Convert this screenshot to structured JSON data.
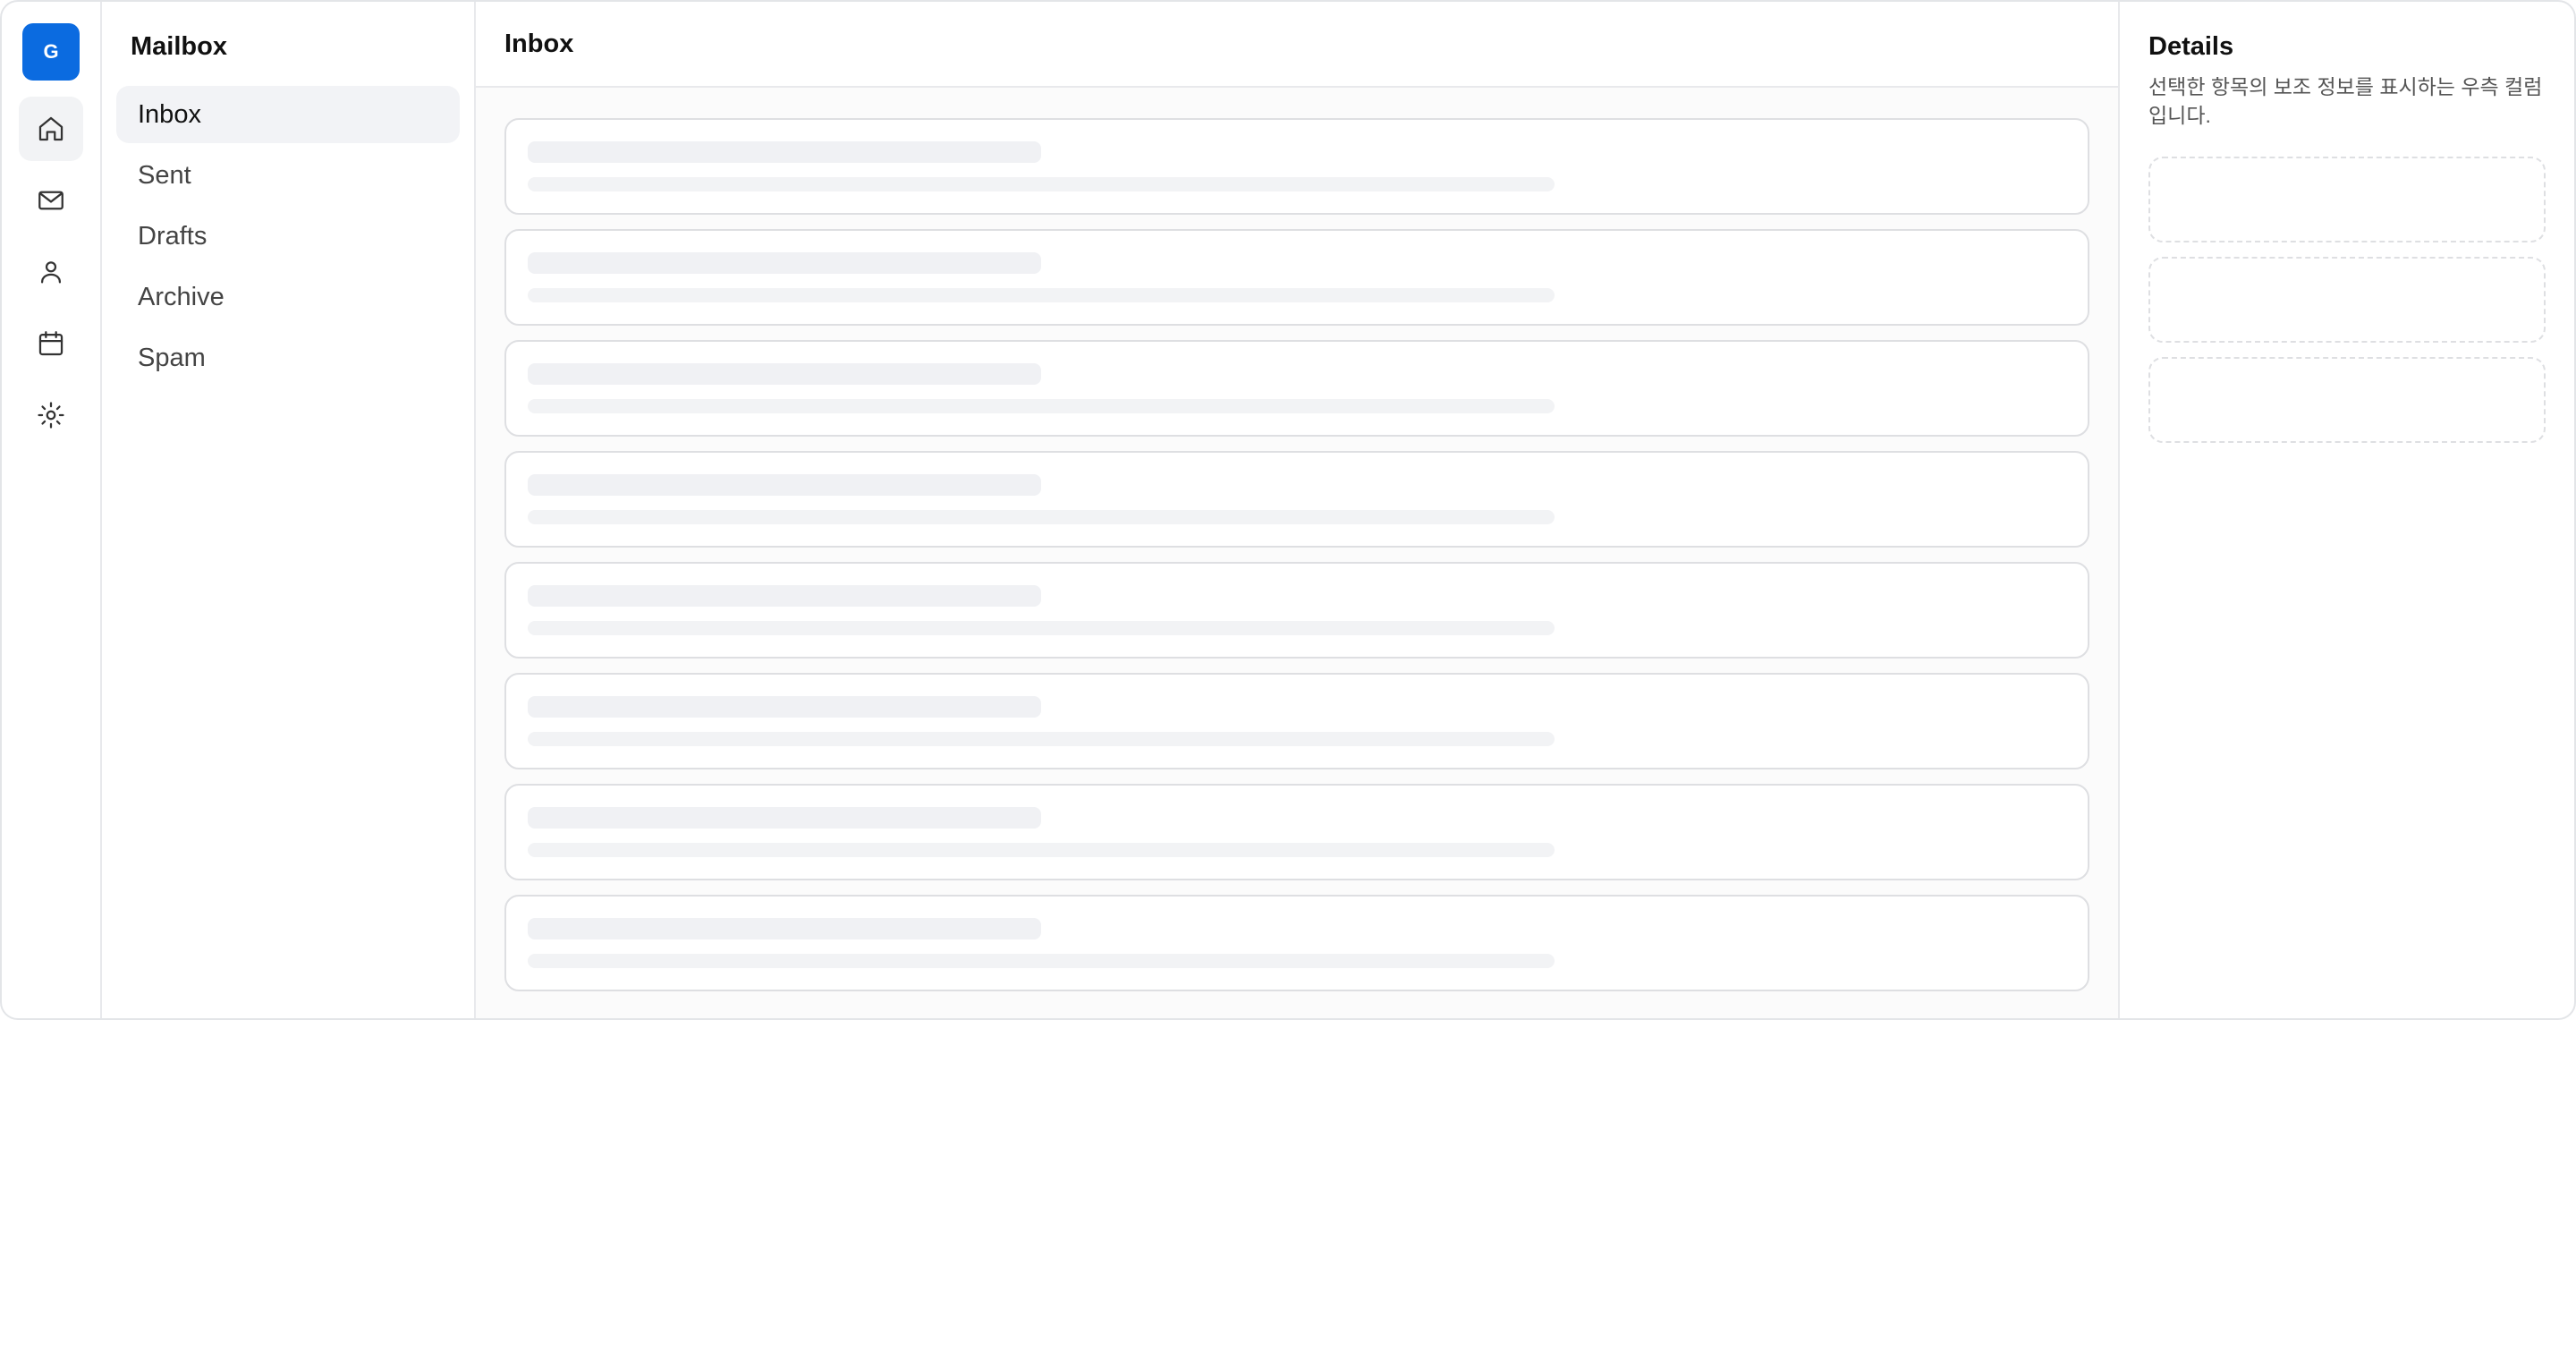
{
  "rail": {
    "avatar_initial": "G",
    "items": [
      {
        "icon": "home-icon",
        "active": true
      },
      {
        "icon": "mail-icon",
        "active": false
      },
      {
        "icon": "user-icon",
        "active": false
      },
      {
        "icon": "calendar-icon",
        "active": false
      },
      {
        "icon": "settings-icon",
        "active": false
      }
    ],
    "accent_color": "#0b6be0"
  },
  "folders": {
    "title": "Mailbox",
    "items": [
      {
        "label": "Inbox",
        "active": true
      },
      {
        "label": "Sent"
      },
      {
        "label": "Drafts"
      },
      {
        "label": "Archive"
      },
      {
        "label": "Spam"
      }
    ]
  },
  "main": {
    "title": "Inbox",
    "skeleton_rows": 8
  },
  "details": {
    "title": "Details",
    "description": "선택한 항목의 보조 정보를 표시하는 우측 컬럼입니다.",
    "placeholders": 3
  }
}
